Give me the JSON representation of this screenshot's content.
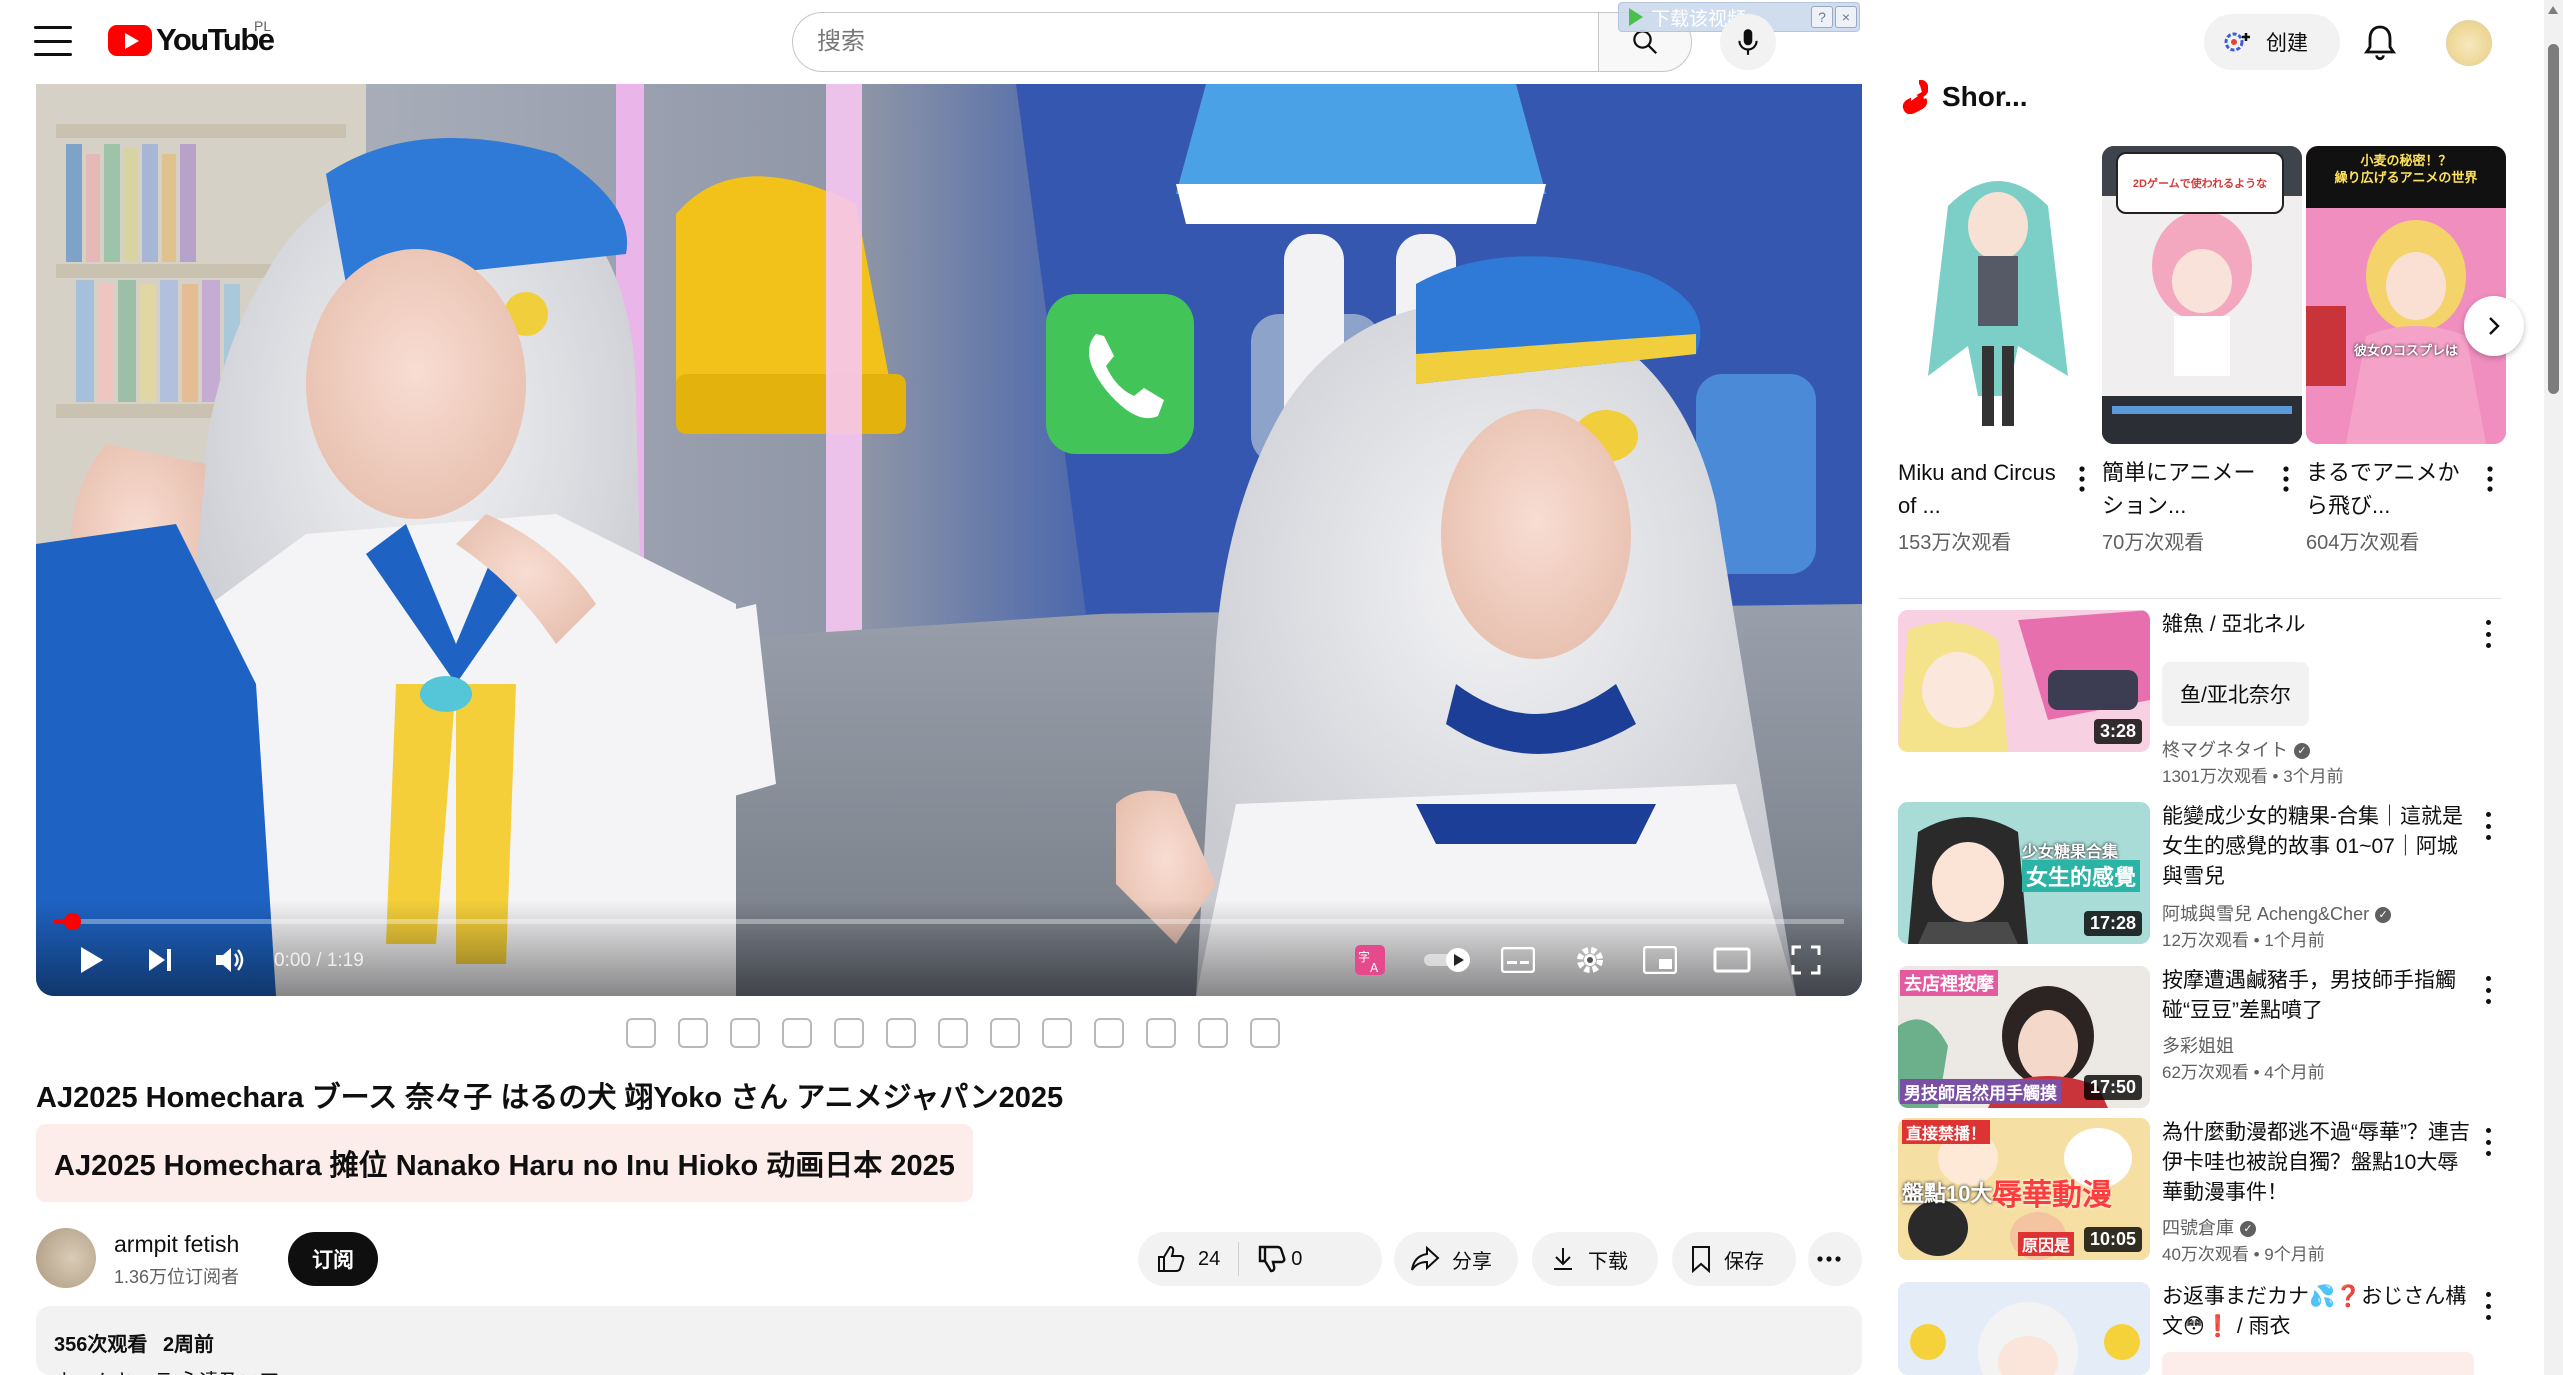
{
  "header": {
    "logo_text": "YouTube",
    "region": "PL",
    "search_placeholder": "搜索",
    "download_overlay": "下载该视频",
    "download_overlay_help": "?",
    "download_overlay_close": "×",
    "create_label": "创建"
  },
  "player": {
    "time": "0:00 / 1:19",
    "progress_fraction": 0.01
  },
  "video": {
    "title": "AJ2025 Homechara ブース 奈々子 はるの犬 翊Yoko さん アニメジャパン2025",
    "translated_title": "AJ2025 Homechara 摊位 Nanako Haru no Inu Hioko 动画日本 2025"
  },
  "channel": {
    "name": "armpit fetish",
    "subscribers": "1.36万位订阅者",
    "subscribe_label": "订阅"
  },
  "actions": {
    "likes": "24",
    "dislikes": "0",
    "share": "分享",
    "download": "下载",
    "save": "保存"
  },
  "description": {
    "views": "356次观看",
    "date": "2周前",
    "text": "ホームキャラ 永遠乃ニア"
  },
  "shorts": {
    "heading": "Shor...",
    "items": [
      {
        "title": "Miku and Circus of ...",
        "views": "153万次观看"
      },
      {
        "title": "簡単にアニメーション...",
        "views": "70万次观看",
        "thumb_text": "2Dゲームで使われるような"
      },
      {
        "title": "まるでアニメから飛び...",
        "views": "604万次观看",
        "thumb_text": "小麦の秘密！？\n繰り広げるアニメの世界",
        "thumb_caption": "彼女のコスプレは"
      }
    ]
  },
  "recommendations": [
    {
      "title": "雑魚 / 亞北ネル",
      "tag": "鱼/亚北奈尔",
      "channel": "柊マグネタイト",
      "meta": "1301万次观看 • 3个月前",
      "duration": "3:28"
    },
    {
      "title": "能變成少女的糖果-合集｜這就是女生的感覺的故事 01~07｜阿城與雪兒",
      "channel": "阿城與雪兒 Acheng&Cher",
      "meta": "12万次观看 • 1个月前",
      "duration": "17:28",
      "thumb_text_top": "少女糖果合集",
      "thumb_text_bottom": "女生的感覺"
    },
    {
      "title": "按摩遭遇鹹豬手，男技師手指觸碰“豆豆”差點噴了",
      "channel": "多彩姐姐",
      "meta": "62万次观看 • 4个月前",
      "duration": "17:50",
      "thumb_text_top": "去店裡按摩",
      "thumb_text_bottom": "男技師居然用手觸摸"
    },
    {
      "title": "為什麼動漫都逃不過“辱華”？連吉伊卡哇也被說自獨？盤點10大辱華動漫事件！",
      "channel": "四號倉庫",
      "meta": "40万次观看 • 9个月前",
      "duration": "10:05",
      "thumb_text_top": "直接禁播！",
      "thumb_text_mid": "盤點10大",
      "thumb_text_big": "辱華動漫",
      "thumb_text_bottom": "原因是"
    },
    {
      "title": "お返事まだカナ💦❓おじさん構文😳❗ / 雨衣",
      "channel": "",
      "meta": "",
      "duration": ""
    }
  ]
}
